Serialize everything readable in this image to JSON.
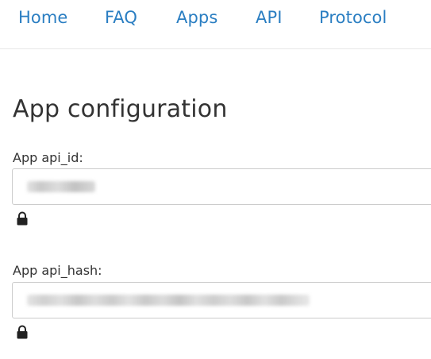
{
  "nav": {
    "items": [
      {
        "label": "Home"
      },
      {
        "label": "FAQ"
      },
      {
        "label": "Apps"
      },
      {
        "label": "API"
      },
      {
        "label": "Protocol"
      }
    ]
  },
  "page": {
    "title": "App configuration"
  },
  "form": {
    "api_id": {
      "label": "App api_id:",
      "icon": "lock-icon"
    },
    "api_hash": {
      "label": "App api_hash:",
      "icon": "lock-icon"
    }
  },
  "colors": {
    "link": "#2a7ec2",
    "text": "#333333",
    "border": "#cccccc"
  }
}
